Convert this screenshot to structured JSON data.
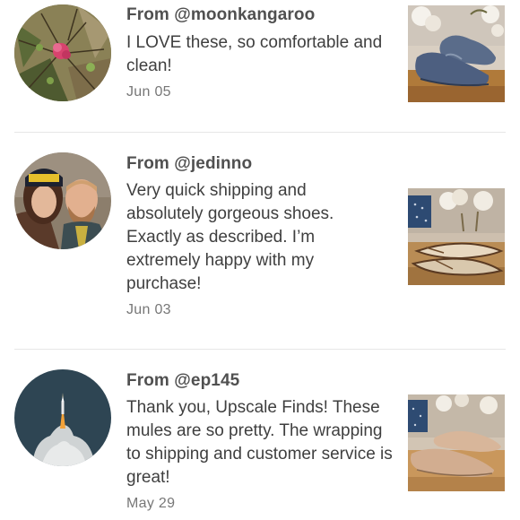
{
  "reviews": [
    {
      "from": "From @moonkangaroo",
      "text": "I LOVE these, so comfortable and clean!",
      "date": "Jun 05",
      "avatar_icon": "pink-flower-avatar",
      "thumb_icon": "blue-slip-on-sneakers-photo"
    },
    {
      "from": "From @jedinno",
      "text": "Very quick shipping and absolutely gorgeous shoes. Exactly as described. I’m extremely happy with my purchase!",
      "date": "Jun 03",
      "avatar_icon": "couple-selfie-avatar",
      "thumb_icon": "pointed-flats-photo"
    },
    {
      "from": "From @ep145",
      "text": "Thank you, Upscale Finds! These mules are so pretty. The wrapping to shipping and customer service is great!",
      "date": "May 29",
      "avatar_icon": "rocket-launch-avatar",
      "thumb_icon": "suede-mules-photo"
    }
  ]
}
